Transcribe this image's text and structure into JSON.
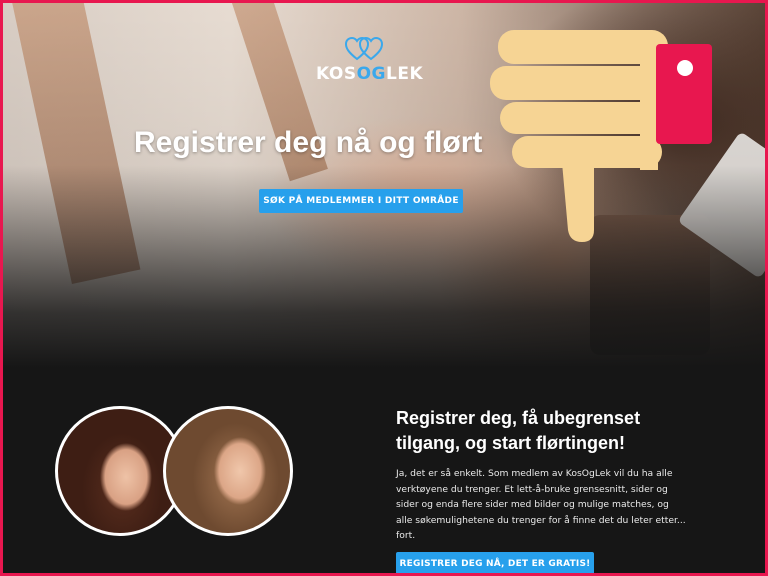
{
  "brand": {
    "logo_part1": "KOS",
    "logo_part2": "OG",
    "logo_part3": "LEK",
    "accent_color": "#27a0ec",
    "frame_color": "#e8174f"
  },
  "hero": {
    "title": "Registrer deg nå og flørt",
    "search_button_label": "SØK PÅ MEDLEMMER I DITT OMRÅDE"
  },
  "overlay": {
    "icon": "thumbs-down-icon"
  },
  "section": {
    "title": "Registrer deg, få ubegrenset tilgang, og start flørtingen!",
    "body": "Ja, det er så enkelt. Som medlem av KosOgLek vil du ha alle verktøyene du trenger. Et lett-å-bruke grensesnitt, sider og sider og enda flere sider med bilder og mulige matches, og alle søkemulighetene du trenger for å finne det du leter etter... fort.",
    "cta_label": "REGISTRER DEG NÅ, DET ER GRATIS!"
  }
}
